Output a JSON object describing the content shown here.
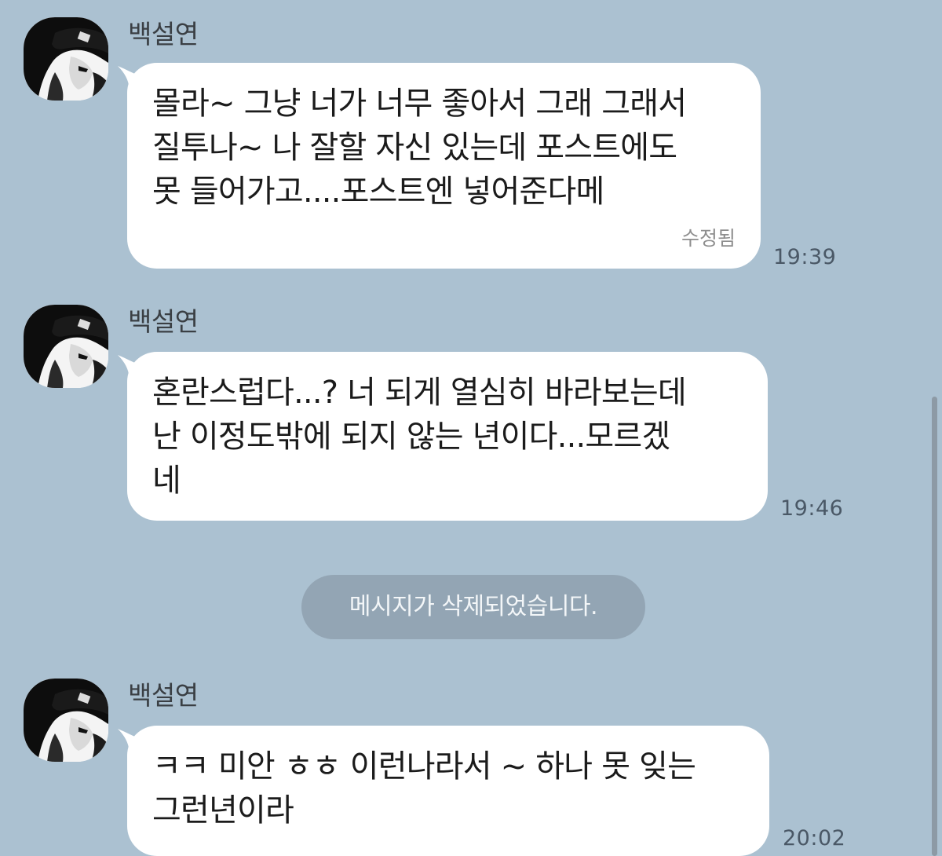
{
  "conversation": {
    "messages": [
      {
        "sender": "백설연",
        "text": "몰라~ 그냥 너가 너무 좋아서 그래 그래서\n질투나~ 나 잘할 자신 있는데 포스트에도\n못 들어가고....포스트엔 넣어준다메",
        "edited_label": "수정됨",
        "time": "19:39"
      },
      {
        "sender": "백설연",
        "text": "혼란스럽다...? 너 되게 열심히 바라보는데\n난 이정도밖에 되지 않는 년이다...모르겠\n네",
        "time": "19:46"
      },
      {
        "sender": "백설연",
        "text": "ㅋㅋ 미안 ㅎㅎ 이런나라서 ~ 하나 못 잊는\n그런년이라",
        "time": "20:02"
      }
    ],
    "system_notice": "메시지가 삭제되었습니다."
  },
  "colors": {
    "background": "#abc1d1",
    "bubble": "#ffffff",
    "system_pill": "#93a5b4"
  }
}
